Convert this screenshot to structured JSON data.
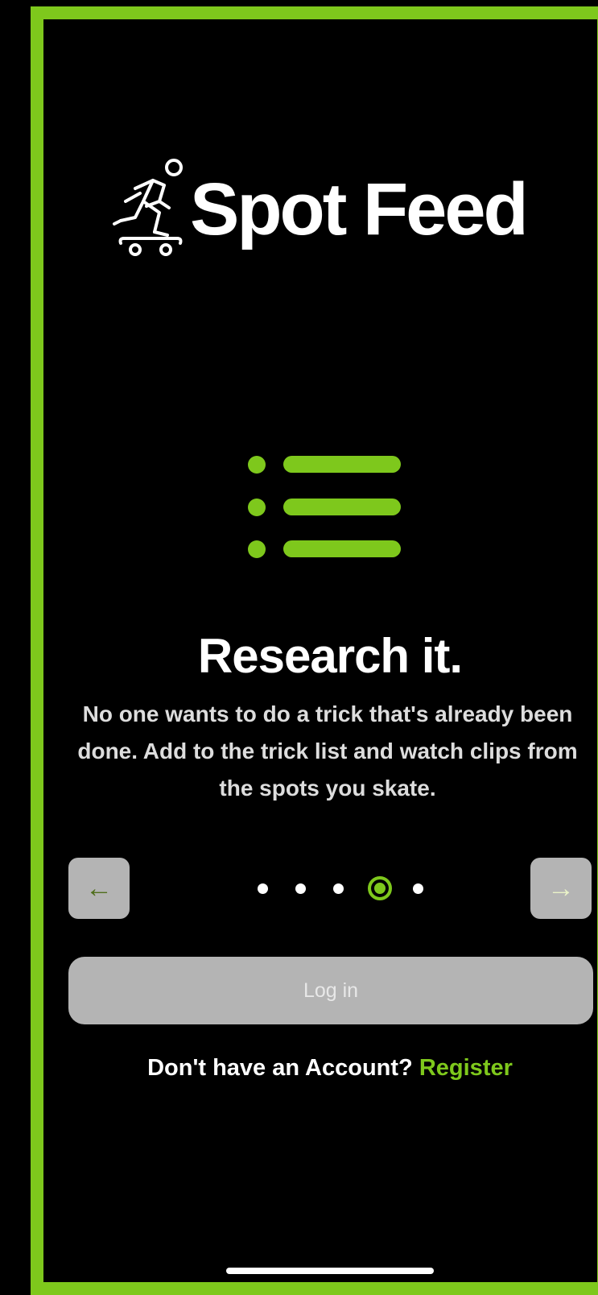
{
  "app": {
    "name": "Spot Feed"
  },
  "onboarding": {
    "title": "Research it.",
    "description": "No one wants to do a trick that's already been done. Add to the trick list and watch clips from the spots you skate.",
    "current_step": 4,
    "total_steps": 5
  },
  "nav": {
    "prev_icon": "arrow-left-icon",
    "prev_glyph": "←",
    "next_icon": "arrow-right-icon",
    "next_glyph": "→"
  },
  "actions": {
    "login_label": "Log in",
    "register_prompt": "Don't have an Account?",
    "register_label": "Register"
  },
  "colors": {
    "accent": "#7ec81c",
    "background": "#000000",
    "button_gray": "#b4b4b4"
  }
}
